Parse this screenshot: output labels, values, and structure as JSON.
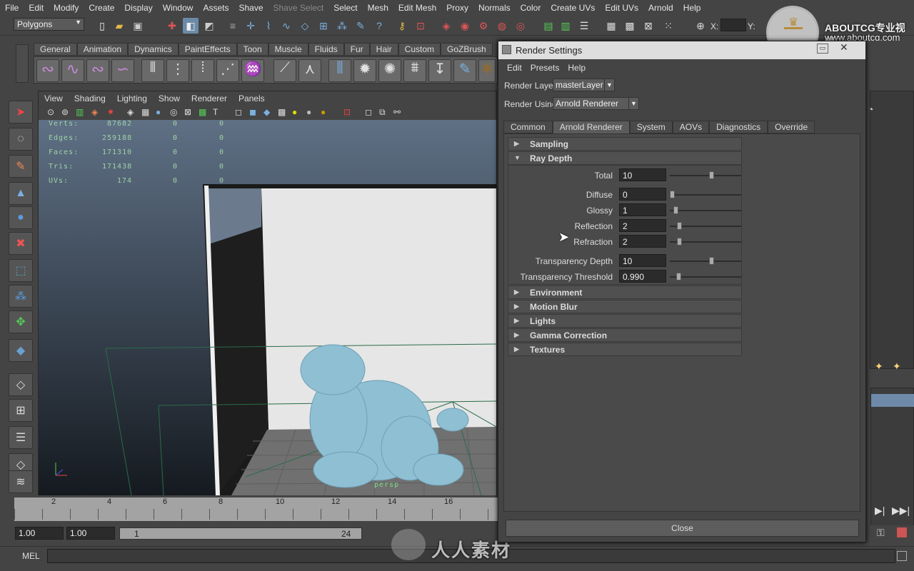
{
  "menubar": {
    "items": [
      "File",
      "Edit",
      "Modify",
      "Create",
      "Display",
      "Window",
      "Assets",
      "Shave",
      "Shave Select",
      "Select",
      "Mesh",
      "Edit Mesh",
      "Proxy",
      "Normals",
      "Color",
      "Create UVs",
      "Edit UVs",
      "Arnold",
      "Help"
    ]
  },
  "status": {
    "mode": "Polygons",
    "x_label": "X:",
    "y_label": "Y:"
  },
  "watermark": {
    "brand": "ABOUTCG专业视频",
    "url": "www.aboutcg.com",
    "bottom": "人人素材"
  },
  "shelf": {
    "tabs": [
      "General",
      "Animation",
      "Dynamics",
      "PaintEffects",
      "Toon",
      "Muscle",
      "Fluids",
      "Fur",
      "Hair",
      "Custom",
      "GoZBrush"
    ]
  },
  "viewport": {
    "menu": [
      "View",
      "Shading",
      "Lighting",
      "Show",
      "Renderer",
      "Panels"
    ],
    "hud": [
      {
        "label": "Verts:",
        "value": "87682",
        "a": "0",
        "b": "0"
      },
      {
        "label": "Edges:",
        "value": "259188",
        "a": "0",
        "b": "0"
      },
      {
        "label": "Faces:",
        "value": "171310",
        "a": "0",
        "b": "0"
      },
      {
        "label": "Tris:",
        "value": "171438",
        "a": "0",
        "b": "0"
      },
      {
        "label": "UVs:",
        "value": "174",
        "a": "0",
        "b": "0"
      }
    ],
    "camera": "persp"
  },
  "timeline": {
    "ticks": [
      "2",
      "4",
      "6",
      "8",
      "10",
      "12",
      "14",
      "16"
    ]
  },
  "range": {
    "start": "1.00",
    "current": "1.00",
    "slider_start": "1",
    "slider_end": "24"
  },
  "cmdline": {
    "label": "MEL"
  },
  "render_settings": {
    "title": "Render Settings",
    "menu": [
      "Edit",
      "Presets",
      "Help"
    ],
    "render_layer_label": "Render Layer",
    "render_layer_value": "masterLayer",
    "render_using_label": "Render Using",
    "render_using_value": "Arnold Renderer",
    "tabs": [
      "Common",
      "Arnold Renderer",
      "System",
      "AOVs",
      "Diagnostics",
      "Override"
    ],
    "active_tab": "Arnold Renderer",
    "sections": {
      "sampling": "Sampling",
      "ray_depth": "Ray Depth",
      "environment": "Environment",
      "motion_blur": "Motion Blur",
      "lights": "Lights",
      "gamma": "Gamma Correction",
      "textures": "Textures"
    },
    "ray_depth": [
      {
        "label": "Total",
        "value": "10",
        "level": 0.55
      },
      {
        "label": "Diffuse",
        "value": "0",
        "level": 0.0
      },
      {
        "label": "Glossy",
        "value": "1",
        "level": 0.05
      },
      {
        "label": "Reflection",
        "value": "2",
        "level": 0.1
      },
      {
        "label": "Refraction",
        "value": "2",
        "level": 0.1
      },
      {
        "label": "Transparency Depth",
        "value": "10",
        "level": 0.55
      },
      {
        "label": "Transparency Threshold",
        "value": "0.990",
        "level": 0.09
      }
    ],
    "close_label": "Close"
  }
}
